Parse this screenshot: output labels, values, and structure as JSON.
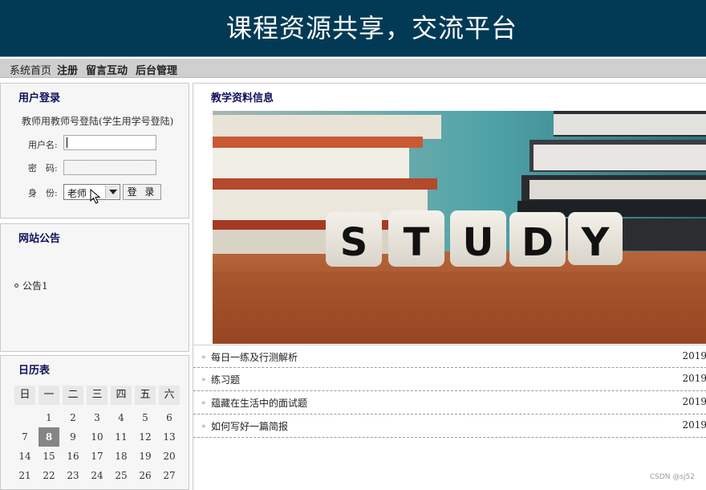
{
  "header": {
    "title": "课程资源共享，交流平台",
    "bg_color": "#023a55"
  },
  "nav": {
    "items": [
      "系统首页",
      "注册",
      "留言互动",
      "后台管理"
    ]
  },
  "login": {
    "title": "用户登录",
    "hint": "教师用教师号登陆(学生用学号登陆)",
    "username_label": "用户名:",
    "password_label": "密　码:",
    "role_label": "身　份:",
    "role_selected": "老师",
    "login_button": "登 录"
  },
  "notice": {
    "title": "网站公告",
    "items": [
      "公告1"
    ]
  },
  "calendar": {
    "title": "日历表",
    "weekdays": [
      "日",
      "一",
      "二",
      "三",
      "四",
      "五",
      "六"
    ],
    "rows": [
      [
        "",
        "1",
        "2",
        "3",
        "4",
        "5",
        "6"
      ],
      [
        "7",
        "8",
        "9",
        "10",
        "11",
        "12",
        "13"
      ],
      [
        "14",
        "15",
        "16",
        "17",
        "18",
        "19",
        "20"
      ],
      [
        "21",
        "22",
        "23",
        "24",
        "25",
        "26",
        "27"
      ]
    ],
    "today": "8"
  },
  "main": {
    "title": "教学资料信息",
    "banner_word": "STUDY",
    "list": [
      {
        "title": "每日一练及行测解析",
        "date": "2019"
      },
      {
        "title": "练习题",
        "date": "2019"
      },
      {
        "title": "蕴藏在生活中的面试题",
        "date": "2019"
      },
      {
        "title": "如何写好一篇简报",
        "date": "2019"
      }
    ]
  },
  "watermark": "CSDN @sj52"
}
